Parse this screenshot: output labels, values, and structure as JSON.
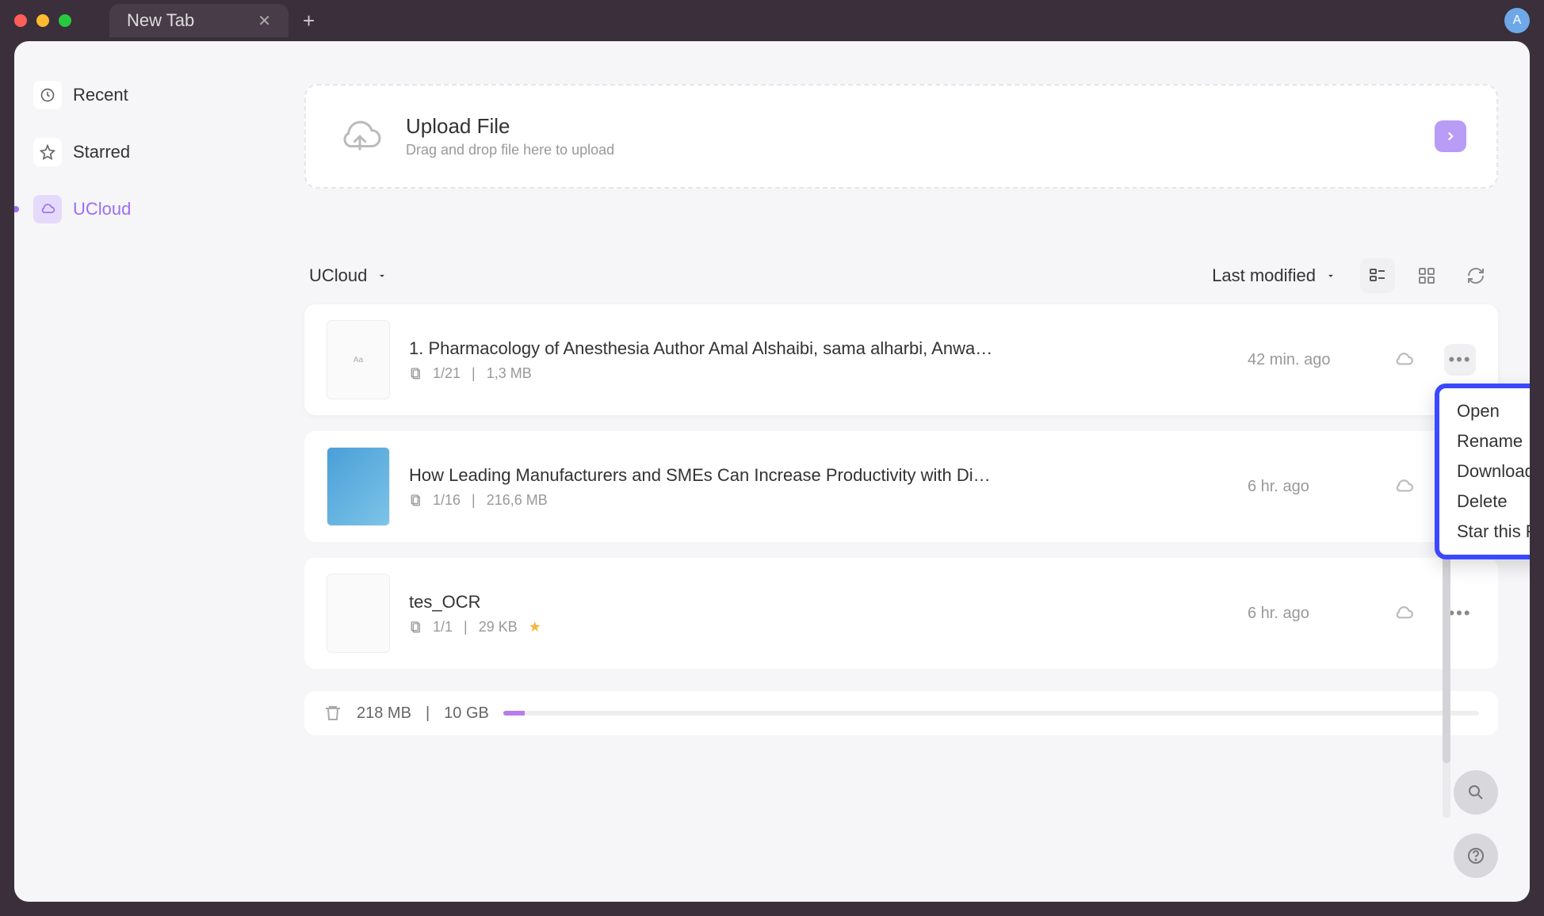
{
  "tab": {
    "title": "New Tab"
  },
  "avatar": {
    "initial": "A"
  },
  "sidebar": {
    "items": [
      {
        "label": "Recent"
      },
      {
        "label": "Starred"
      },
      {
        "label": "UCloud"
      }
    ]
  },
  "upload": {
    "title": "Upload File",
    "subtitle": "Drag and drop file here to upload"
  },
  "toolbar": {
    "location": "UCloud",
    "sort": "Last modified"
  },
  "files": [
    {
      "name": "1. Pharmacology of Anesthesia Author Amal Alshaibi, sama alharbi, Anwa…",
      "pages": "1/21",
      "size": "1,3 MB",
      "time": "42 min. ago",
      "starred": false
    },
    {
      "name": "How Leading Manufacturers and SMEs Can Increase Productivity with Di…",
      "pages": "1/16",
      "size": "216,6 MB",
      "time": "6 hr. ago",
      "starred": false
    },
    {
      "name": "tes_OCR",
      "pages": "1/1",
      "size": "29 KB",
      "time": "6 hr. ago",
      "starred": true
    }
  ],
  "context_menu": {
    "items": [
      "Open",
      "Rename",
      "Download",
      "Delete",
      "Star this File"
    ]
  },
  "storage": {
    "used": "218 MB",
    "total": "10 GB"
  }
}
